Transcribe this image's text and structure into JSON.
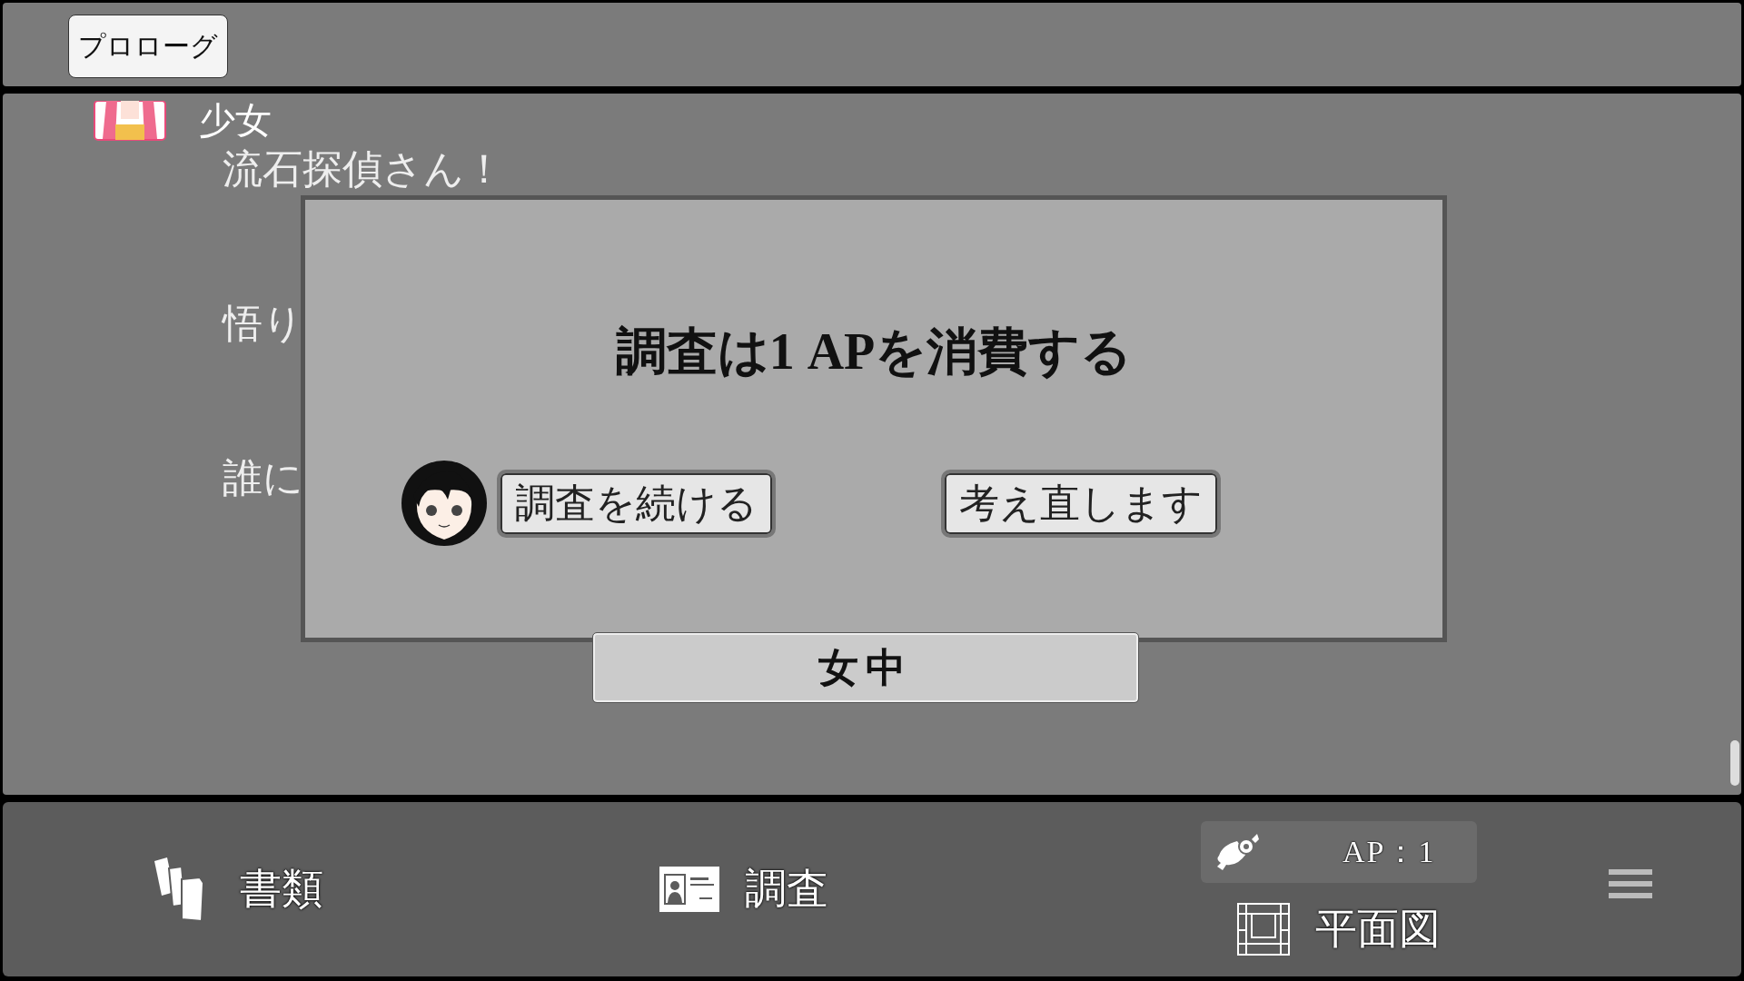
{
  "top_bar": {
    "chapter_button": "プロローグ"
  },
  "log": {
    "speaker": "少女",
    "messages": [
      "流石探偵さん！",
      "悟り",
      "誰に"
    ]
  },
  "dialog": {
    "title": "調査は1 APを消費する",
    "buttons": [
      "調査を続ける",
      "考え直します"
    ]
  },
  "choice_button": "女中",
  "bottom_bar": {
    "documents": "書類",
    "investigate": "調査",
    "ap": "AP：1",
    "floor_plan": "平面図"
  }
}
